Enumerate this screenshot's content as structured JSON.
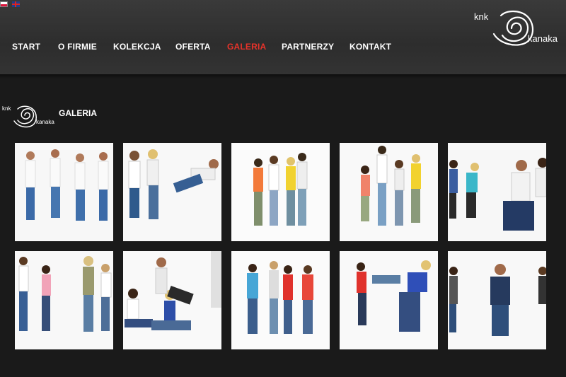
{
  "nav": {
    "items": [
      "START",
      "O FIRMIE",
      "KOLEKCJA",
      "OFERTA",
      "GALERIA",
      "PARTNERZY",
      "KONTAKT"
    ],
    "active": "GALERIA",
    "active_color": "#e8332a"
  },
  "logo": {
    "line1": "knk",
    "line2": "kanaka"
  },
  "section": {
    "title": "GALERIA"
  },
  "flags": [
    "flag-pl-icon",
    "flag-en-icon"
  ],
  "gallery": {
    "rows": 2,
    "columns": 5,
    "items": [
      {
        "alt": "group-of-four-in-tank-tops"
      },
      {
        "alt": "three-models-jumping"
      },
      {
        "alt": "four-models-colorful-tops"
      },
      {
        "alt": "dancing-group"
      },
      {
        "alt": "pair-pulling-cropped"
      },
      {
        "alt": "four-models-hats"
      },
      {
        "alt": "couple-sitting"
      },
      {
        "alt": "five-models-group"
      },
      {
        "alt": "couple-tug-of-war"
      },
      {
        "alt": "model-in-blazer-cropped"
      }
    ]
  }
}
